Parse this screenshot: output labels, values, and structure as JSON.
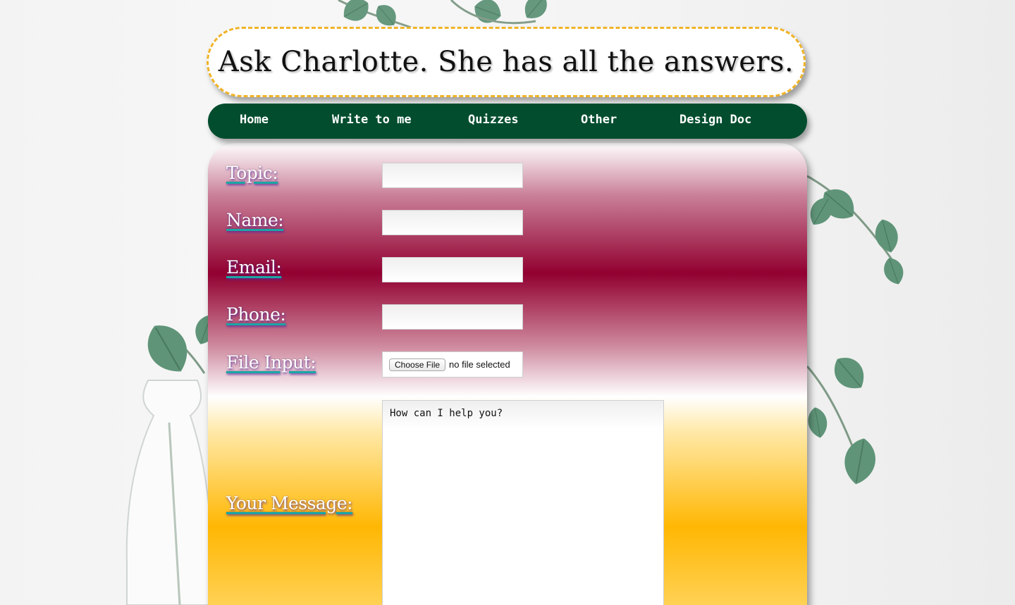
{
  "site": {
    "title": "Ask Charlotte. She has all the answers."
  },
  "nav": {
    "items": [
      {
        "label": "Home"
      },
      {
        "label": "Write to me"
      },
      {
        "label": "Quizzes"
      },
      {
        "label": "Other"
      },
      {
        "label": "Design Doc"
      }
    ]
  },
  "form": {
    "topic_label": "Topic:",
    "topic_value": "",
    "name_label": "Name:",
    "name_value": "",
    "email_label": "Email:",
    "email_value": "",
    "phone_label": "Phone:",
    "phone_value": "",
    "file_label": "File Input:",
    "file_button": "Choose File",
    "file_status": "no file selected",
    "message_label": "Your Message:",
    "message_placeholder": "How can I help you?"
  },
  "icons": {
    "background": "eucalyptus-plant-in-glass-vase"
  },
  "colors": {
    "nav_background": "#014d2e",
    "header_border": "#f0b429",
    "panel_top": "#920030",
    "panel_bottom": "#ffb703",
    "label_underline": "#1aa6a6"
  }
}
